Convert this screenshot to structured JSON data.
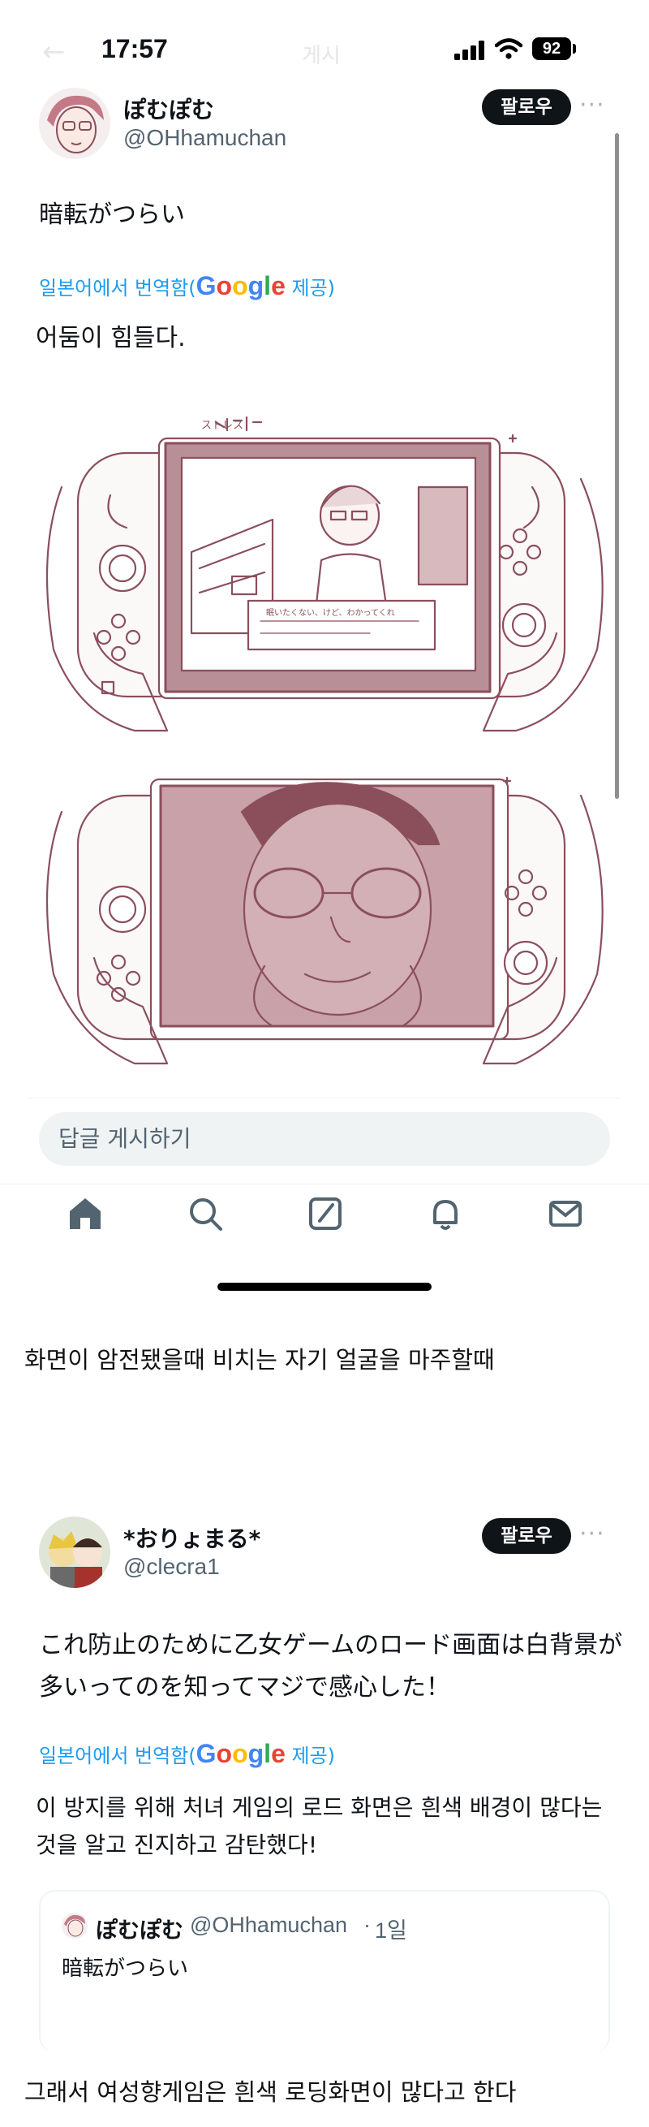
{
  "status_bar": {
    "time": "17:57",
    "title_ghost": "게시",
    "battery": "92"
  },
  "tweet1": {
    "display_name": "ぽむぽむ",
    "handle": "@OHhamuchan",
    "follow_label": "팔로우",
    "more": "···",
    "text": "暗転がつらい",
    "translate_prefix": "일본어에서 번역함(",
    "translate_suffix": " 제공)",
    "google": [
      "G",
      "o",
      "o",
      "g",
      "l",
      "e"
    ],
    "translation": "어둠이 힘들다."
  },
  "illustration": {
    "top_caption": "ストレス",
    "dialog_text": "眠いたくない、けど、わかってくれ"
  },
  "reply_placeholder": "답글 게시하기",
  "tabbar": {
    "items": [
      "home-icon",
      "search-icon",
      "compose-icon",
      "notifications-icon",
      "messages-icon"
    ]
  },
  "caption1": "화면이 암전됐을때 비치는 자기 얼굴을 마주할때",
  "tweet2": {
    "display_name": "*おりょまる*",
    "handle": "@clecra1",
    "follow_label": "팔로우",
    "more": "···",
    "text_line1": "これ防止のために乙女ゲームのロード画面は白背景が",
    "text_line2": "多いってのを知ってマジで感心した！",
    "translate_prefix": "일본어에서 번역함(",
    "translate_suffix": " 제공)",
    "translation_line1": "이 방지를 위해 처녀 게임의 로드 화면은 흰색 배경이 많다는",
    "translation_line2": "것을 알고 진지하고 감탄했다!",
    "quote": {
      "display_name": "ぽむぽむ",
      "handle": "@OHhamuchan",
      "dot": "·",
      "age": "1일",
      "text": "暗転がつらい"
    }
  },
  "caption2": "그래서 여성향게임은 흰색 로딩화면이 많다고 한다",
  "colors": {
    "accent": "#1d9bf0",
    "sketch": "#8b4f5c",
    "screen_fill": "#c8a2a8"
  }
}
